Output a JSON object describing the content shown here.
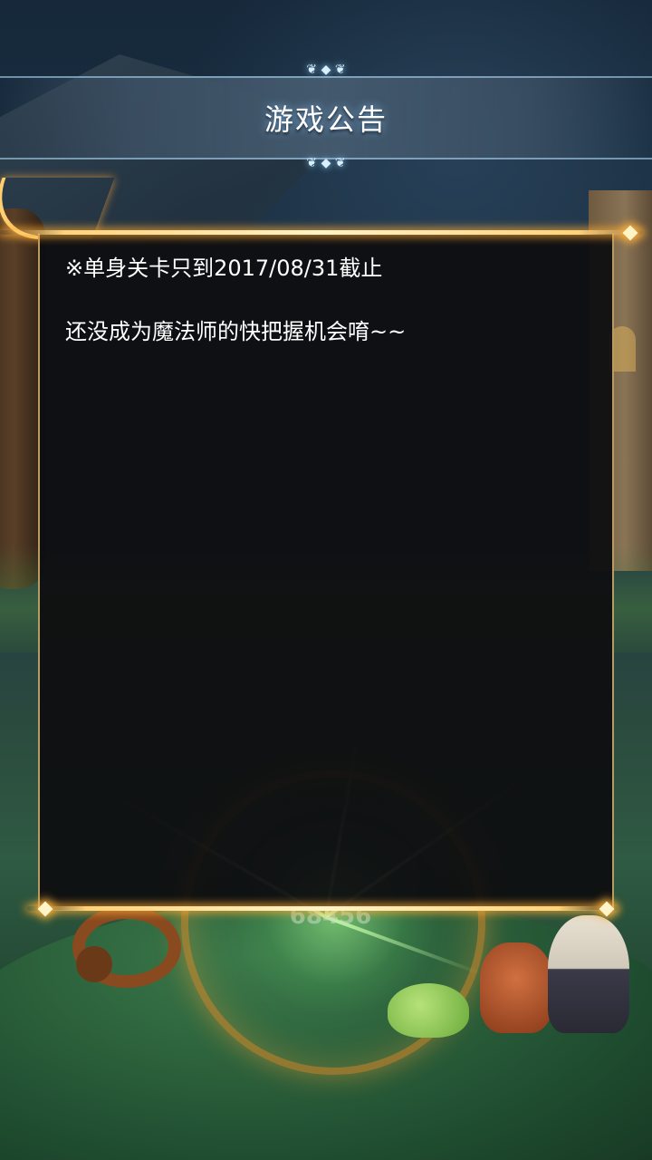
{
  "title": "游戏公告",
  "notice": {
    "lines": [
      "※单身关卡只到2017/08/31截止",
      "还没成为魔法师的快把握机会唷~~"
    ]
  },
  "background": {
    "score_text": "68456"
  },
  "colors": {
    "panel_border": "#b89a62",
    "gold_glow": "#ffd27a",
    "title_glow": "#8fd0ff"
  }
}
